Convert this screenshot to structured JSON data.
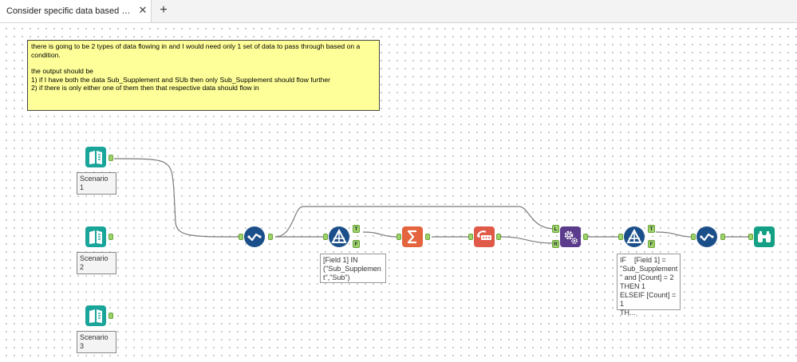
{
  "tabs": [
    {
      "label": "Consider specific data based on the sin...",
      "close_glyph": "✕"
    }
  ],
  "add_tab_glyph": "+",
  "comment": {
    "line1": "there is going to be 2 types of data flowing in and I would need only 1 set of data to pass through based on a condition.",
    "line2": "the output should be",
    "line3": "1) if I have both the data Sub_Supplement and SUb then only Sub_Supplement should flow further",
    "line4": "2) if there is only either one of them then that respective data should flow in"
  },
  "inputs": [
    {
      "label": "Scenario 1"
    },
    {
      "label": "Scenario 2"
    },
    {
      "label": "Scenario 3"
    }
  ],
  "filter1_annotation": "[Field 1] IN\n(\"Sub_Supplemen\nt\",\"Sub\")",
  "filter2_annotation": "IF    [Field 1] =\n\"Sub_Supplement\n\" and [Count] = 2\nTHEN 1\nELSEIF [Count] = 1\nTH...",
  "anchor_labels": {
    "true": "T",
    "false": "F",
    "left": "L",
    "right": "R"
  },
  "colors": {
    "input_teal": "#1aa59a",
    "join_blue": "#1b4f8a",
    "summarize_orange": "#e4643d",
    "multirow_red": "#e05a4a",
    "macro_purple": "#5b3b8c",
    "browse_teal": "#13a084",
    "comment_yellow": "#ffff99"
  }
}
